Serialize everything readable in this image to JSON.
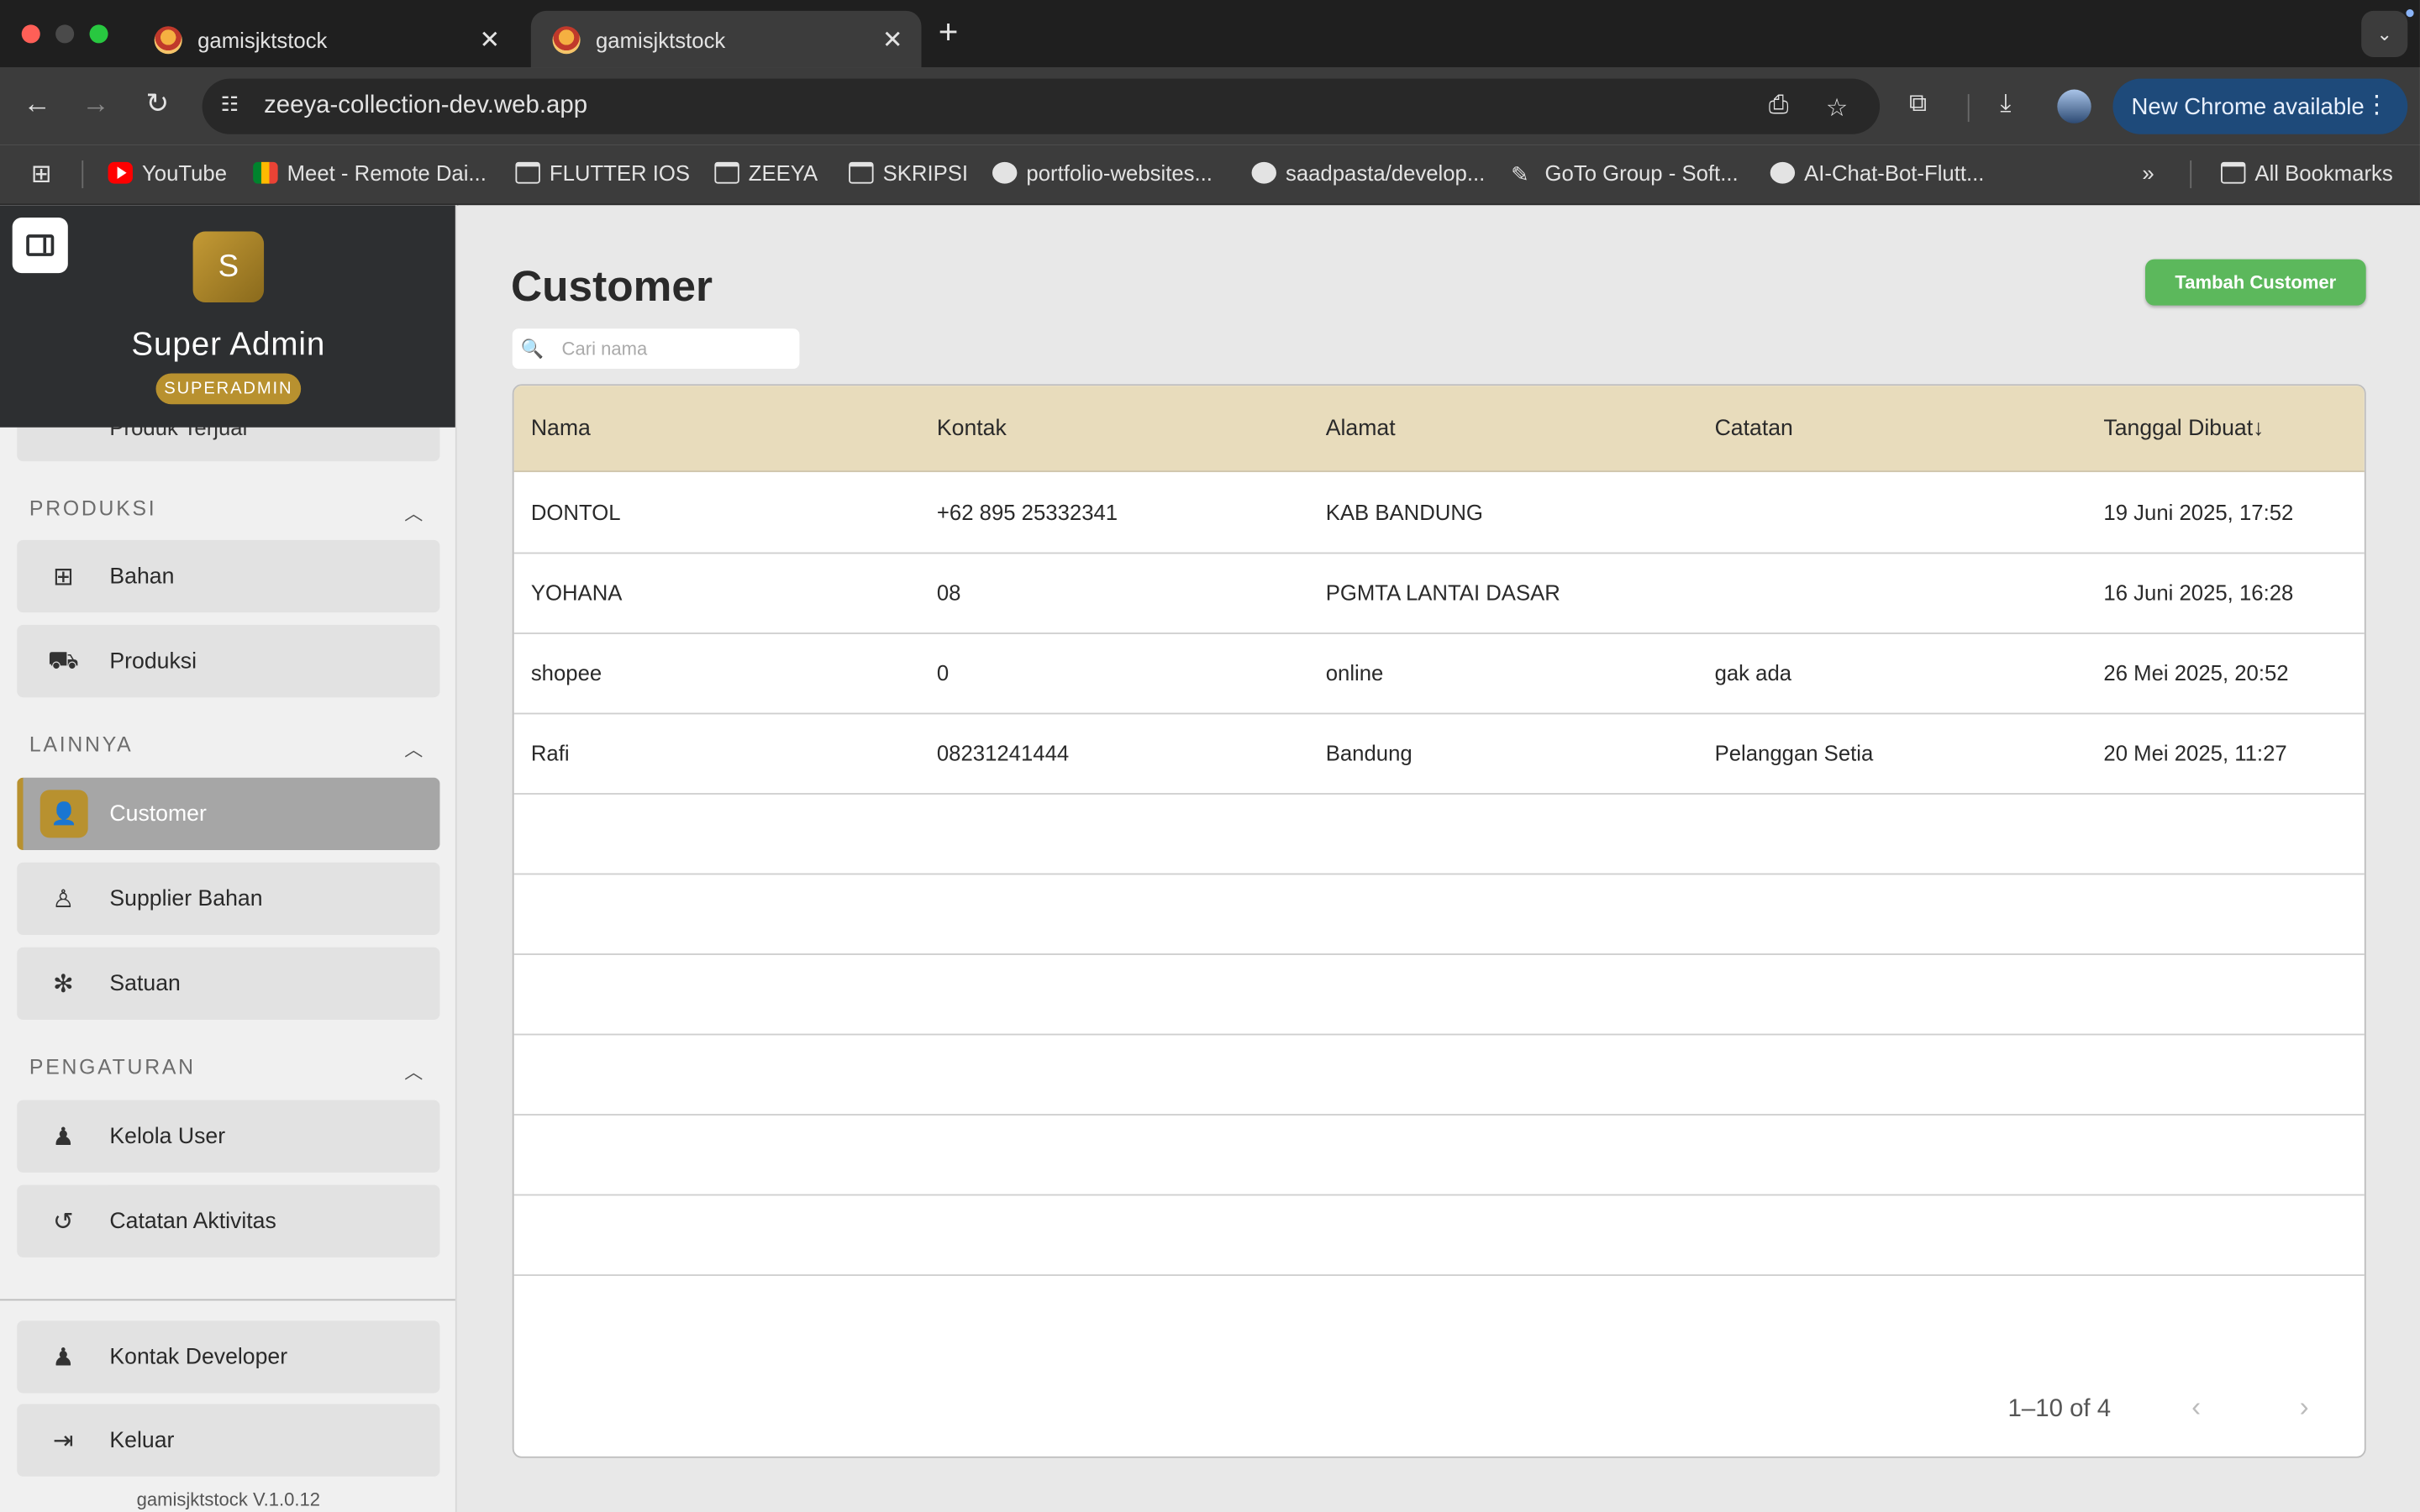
{
  "browser": {
    "tabs": [
      {
        "title": "gamisjktstock",
        "active": false
      },
      {
        "title": "gamisjktstock",
        "active": true
      }
    ],
    "url": "zeeya-collection-dev.web.app",
    "update_label": "New Chrome available",
    "bookmarks": [
      {
        "label": "YouTube",
        "icon": "youtube-icon"
      },
      {
        "label": "Meet - Remote Dai...",
        "icon": "meet-icon"
      },
      {
        "label": "FLUTTER IOS",
        "icon": "folder-icon"
      },
      {
        "label": "ZEEYA",
        "icon": "folder-icon"
      },
      {
        "label": "SKRIPSI",
        "icon": "folder-icon"
      },
      {
        "label": "portfolio-websites...",
        "icon": "github-icon"
      },
      {
        "label": "saadpasta/develop...",
        "icon": "github-icon"
      },
      {
        "label": "GoTo Group - Soft...",
        "icon": "goto-icon"
      },
      {
        "label": "AI-Chat-Bot-Flutt...",
        "icon": "github-icon"
      }
    ],
    "all_bookmarks": "All Bookmarks"
  },
  "sidebar": {
    "avatar_letter": "S",
    "user_name": "Super Admin",
    "role": "SUPERADMIN",
    "partial_item": "Produk Terjual",
    "sections": [
      {
        "label": "PRODUKSI",
        "items": [
          {
            "label": "Bahan",
            "icon": "table-icon"
          },
          {
            "label": "Produksi",
            "icon": "cart-icon"
          }
        ]
      },
      {
        "label": "LAINNYA",
        "items": [
          {
            "label": "Customer",
            "icon": "person-add-icon"
          },
          {
            "label": "Supplier Bahan",
            "icon": "person-icon"
          },
          {
            "label": "Satuan",
            "icon": "snowflake-icon"
          }
        ]
      },
      {
        "label": "PENGATURAN",
        "items": [
          {
            "label": "Kelola User",
            "icon": "person-icon"
          },
          {
            "label": "Catatan Aktivitas",
            "icon": "history-icon"
          }
        ]
      }
    ],
    "bottom": [
      {
        "label": "Kontak Developer",
        "icon": "person-icon"
      },
      {
        "label": "Keluar",
        "icon": "logout-icon"
      }
    ],
    "version": "gamisjktstock V.1.0.12"
  },
  "main": {
    "title": "Customer",
    "add_button": "Tambah Customer",
    "search_placeholder": "Cari nama",
    "columns": [
      "Nama",
      "Kontak",
      "Alamat",
      "Catatan",
      "Tanggal Dibuat"
    ],
    "rows": [
      {
        "nama": "DONTOL",
        "kontak": "+62 895 25332341",
        "alamat": "KAB BANDUNG",
        "catatan": "",
        "tanggal": "19 Juni 2025, 17:52"
      },
      {
        "nama": "YOHANA",
        "kontak": "08",
        "alamat": "PGMTA LANTAI DASAR",
        "catatan": "",
        "tanggal": "16 Juni 2025, 16:28"
      },
      {
        "nama": "shopee",
        "kontak": "0",
        "alamat": "online",
        "catatan": "gak ada",
        "tanggal": "26 Mei 2025, 20:52"
      },
      {
        "nama": "Rafi",
        "kontak": "08231241444",
        "alamat": "Bandung",
        "catatan": "Pelanggan Setia",
        "tanggal": "20 Mei 2025, 11:27"
      }
    ],
    "pagination": "1–10 of 4"
  },
  "colors": {
    "accent": "#b8912f",
    "add_button": "#5cb85c",
    "table_header": "#e8dcbc",
    "sidebar_header": "#2d2f31"
  }
}
